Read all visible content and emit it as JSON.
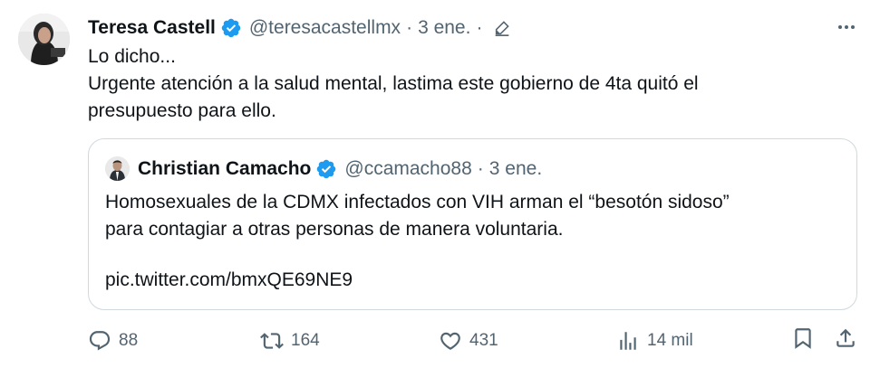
{
  "tweet": {
    "author_name": "Teresa Castell",
    "handle": "@teresacastellmx",
    "separator": "·",
    "date": "3 ene.",
    "text_line1": "Lo dicho...",
    "text_line2": "Urgente atención a la salud mental, lastima este gobierno de 4ta quitó el presupuesto para ello.",
    "icons": {
      "verified": "verified-badge-icon",
      "edited": "edit-pencil-icon",
      "more": "more-dots-icon"
    }
  },
  "quote": {
    "author_name": "Christian Camacho",
    "handle": "@ccamacho88",
    "separator": "·",
    "date": "3 ene.",
    "text_line1": "Homosexuales de la CDMX infectados con VIH arman el “besotón sidoso”",
    "text_line2": "para contagiar a otras personas de manera voluntaria.",
    "link": "pic.twitter.com/bmxQE69NE9"
  },
  "actions": {
    "replies": "88",
    "reposts": "164",
    "likes": "431",
    "views": "14 mil"
  },
  "colors": {
    "text": "#0f1419",
    "muted": "#536471",
    "verified_blue": "#1d9bf0",
    "border": "#cfd9de"
  }
}
